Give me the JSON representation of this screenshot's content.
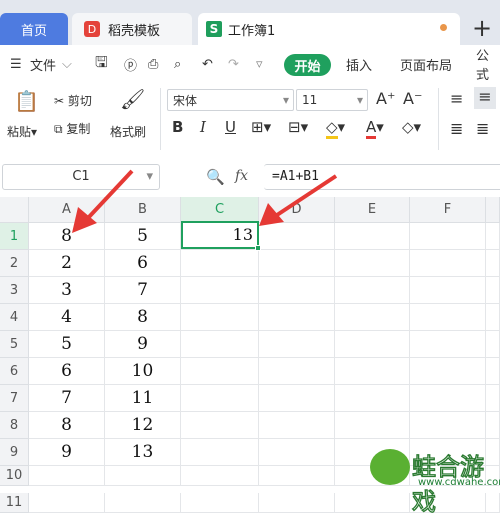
{
  "tabs": {
    "home": "首页",
    "template": "稻壳模板",
    "workbook": "工作簿1",
    "template_icon": "D",
    "workbook_icon": "S"
  },
  "menu": {
    "file": "文件",
    "start": "开始",
    "insert": "插入",
    "layout": "页面布局",
    "formula": "公式"
  },
  "ribbon": {
    "paste": "粘贴",
    "cut": "剪切",
    "copy": "复制",
    "format_painter": "格式刷",
    "font_name": "宋体",
    "font_size": "11",
    "bold": "B",
    "italic": "I",
    "underline": "U"
  },
  "formula_bar": {
    "cell_ref": "C1",
    "fx": "fx",
    "formula": "=A1+B1"
  },
  "columns": [
    "A",
    "B",
    "C",
    "D",
    "E",
    "F"
  ],
  "rows": [
    {
      "n": "1",
      "a": "8",
      "b": "5",
      "c": "13"
    },
    {
      "n": "2",
      "a": "2",
      "b": "6",
      "c": ""
    },
    {
      "n": "3",
      "a": "3",
      "b": "7",
      "c": ""
    },
    {
      "n": "4",
      "a": "4",
      "b": "8",
      "c": ""
    },
    {
      "n": "5",
      "a": "5",
      "b": "9",
      "c": ""
    },
    {
      "n": "6",
      "a": "6",
      "b": "10",
      "c": ""
    },
    {
      "n": "7",
      "a": "7",
      "b": "11",
      "c": ""
    },
    {
      "n": "8",
      "a": "8",
      "b": "12",
      "c": ""
    },
    {
      "n": "9",
      "a": "9",
      "b": "13",
      "c": ""
    },
    {
      "n": "10",
      "a": "",
      "b": "",
      "c": ""
    },
    {
      "n": "11",
      "a": "",
      "b": "",
      "c": ""
    }
  ],
  "watermark": {
    "title": "蛙合游戏",
    "site": "www.cdwahe.com"
  },
  "colors": {
    "accent": "#1fa05e",
    "arrow": "#e53935",
    "home_tab": "#4e7be0"
  }
}
